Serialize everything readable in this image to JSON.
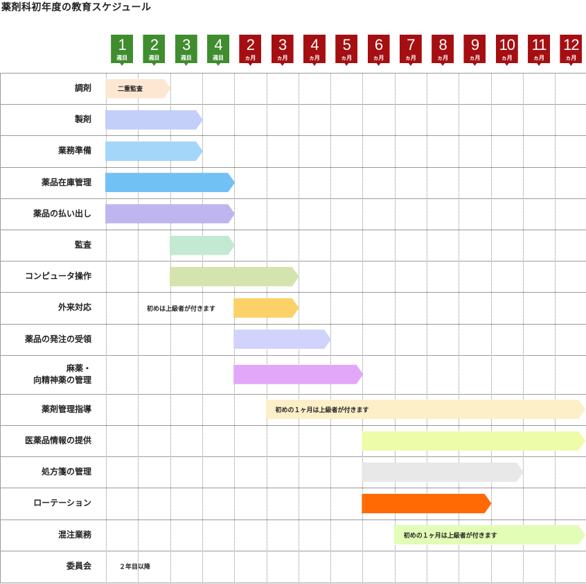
{
  "title": "薬剤科初年度の教育スケジュール",
  "columns": [
    {
      "num": "1",
      "unit": "週目",
      "kind": "week"
    },
    {
      "num": "2",
      "unit": "週目",
      "kind": "week"
    },
    {
      "num": "3",
      "unit": "週目",
      "kind": "week"
    },
    {
      "num": "4",
      "unit": "週目",
      "kind": "week"
    },
    {
      "num": "2",
      "unit": "ヵ月",
      "kind": "month"
    },
    {
      "num": "3",
      "unit": "ヵ月",
      "kind": "month"
    },
    {
      "num": "4",
      "unit": "ヵ月",
      "kind": "month"
    },
    {
      "num": "5",
      "unit": "ヵ月",
      "kind": "month"
    },
    {
      "num": "6",
      "unit": "ヵ月",
      "kind": "month"
    },
    {
      "num": "7",
      "unit": "ヵ月",
      "kind": "month"
    },
    {
      "num": "8",
      "unit": "ヵ月",
      "kind": "month"
    },
    {
      "num": "9",
      "unit": "ヵ月",
      "kind": "month"
    },
    {
      "num": "10",
      "unit": "ヵ月",
      "kind": "month"
    },
    {
      "num": "11",
      "unit": "ヵ月",
      "kind": "month"
    },
    {
      "num": "12",
      "unit": "ヵ月",
      "kind": "month"
    }
  ],
  "rows": [
    {
      "label": "調剤",
      "bar": {
        "start": 1,
        "end": 2,
        "color": "#fde7d3",
        "text": "二重監査"
      }
    },
    {
      "label": "製剤",
      "bar": {
        "start": 1,
        "end": 3,
        "color": "#c3cff9",
        "text": ""
      }
    },
    {
      "label": "業務準備",
      "bar": {
        "start": 1,
        "end": 3,
        "color": "#a3d6f8",
        "text": ""
      }
    },
    {
      "label": "薬品在庫管理",
      "bar": {
        "start": 1,
        "end": 4,
        "color": "#72c1f4",
        "text": ""
      }
    },
    {
      "label": "薬品の払い出し",
      "bar": {
        "start": 1,
        "end": 4,
        "color": "#c0b6ef",
        "text": ""
      }
    },
    {
      "label": "監査",
      "bar": {
        "start": 3,
        "end": 4,
        "color": "#c3e9d2",
        "text": ""
      }
    },
    {
      "label": "コンピュータ操作",
      "bar": {
        "start": 3,
        "end": 6,
        "color": "#d4e4ad",
        "text": ""
      }
    },
    {
      "label": "外来対応",
      "bar": {
        "start": 5,
        "end": 6,
        "color": "#fcd168",
        "text": ""
      },
      "note": "初めは上級者が付きます"
    },
    {
      "label": "薬品の発注の受領",
      "bar": {
        "start": 5,
        "end": 7,
        "color": "#d1d3fd",
        "text": ""
      }
    },
    {
      "label": "麻薬・\n向精神薬の管理",
      "bar": {
        "start": 5,
        "end": 8,
        "color": "#e3a7f9",
        "text": ""
      }
    },
    {
      "label": "薬剤管理指導",
      "bar": {
        "start": 6,
        "end": 15,
        "color": "#fdefc7",
        "text": "初めの１ヶ月は上級者が付きます"
      }
    },
    {
      "label": "医薬品情報の提供",
      "bar": {
        "start": 9,
        "end": 15,
        "color": "#ecfca8",
        "text": ""
      }
    },
    {
      "label": "処方箋の管理",
      "bar": {
        "start": 9,
        "end": 13,
        "color": "#e8e8e8",
        "text": ""
      }
    },
    {
      "label": "ローテーション",
      "bar": {
        "start": 9,
        "end": 12,
        "color": "#ff6a05",
        "text": ""
      }
    },
    {
      "label": "混注業務",
      "bar": {
        "start": 10,
        "end": 15,
        "color": "#e2fdb6",
        "text": "初めの１ヶ月は上級者が付きます"
      }
    },
    {
      "label": "委員会",
      "bar": null,
      "note": "２年目以降"
    }
  ]
}
